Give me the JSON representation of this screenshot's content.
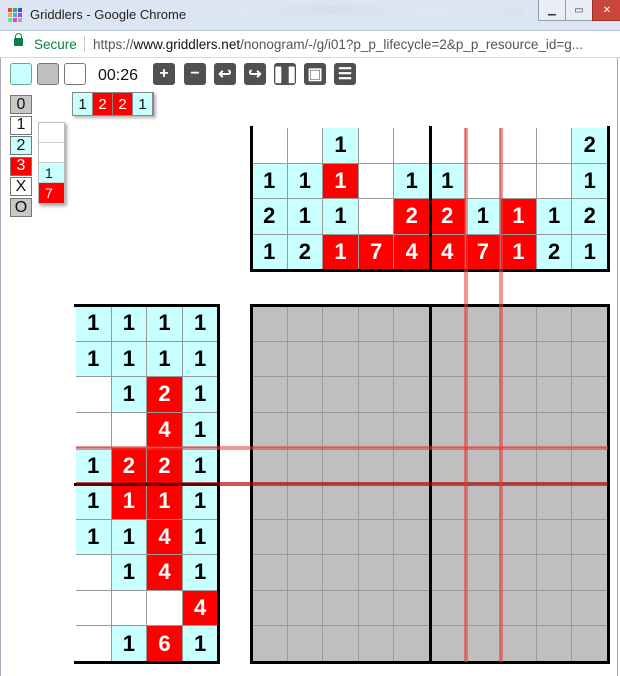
{
  "window": {
    "title": "Griddlers - Google Chrome",
    "minimize": "▁",
    "maximize": "▭",
    "close": "✕"
  },
  "address": {
    "secure_label": "Secure",
    "url_prefix": "https://",
    "url_host": "www.griddlers.net",
    "url_path": "/nonogram/-/g/i01?p_p_lifecycle=2&p_p_resource_id=g..."
  },
  "toolbar": {
    "timer": "00:26",
    "buttons": [
      "zoom-in",
      "zoom-out",
      "undo",
      "redo",
      "pause",
      "save",
      "menu"
    ],
    "icons": [
      "+",
      "−",
      "↩",
      "↪",
      "❚❚",
      "▣",
      "☰"
    ]
  },
  "palette": [
    {
      "label": "0"
    },
    {
      "label": "1"
    },
    {
      "label": "2"
    },
    {
      "label": "3"
    },
    {
      "label": "X"
    },
    {
      "label": "O"
    }
  ],
  "palette_colors": [
    "#c8c8c8",
    "#ffffff",
    "#c8ffff",
    "#ff0000",
    "#ffffff",
    "#c8c8c8"
  ],
  "column_tip": [
    " ",
    " ",
    "1",
    "7"
  ],
  "row_tip": [
    {
      "v": "1",
      "c": 1
    },
    {
      "v": "2",
      "c": 2
    },
    {
      "v": "2",
      "c": 2
    },
    {
      "v": "1",
      "c": 1
    }
  ],
  "colors": {
    "1": "#c8ffff",
    "2": "#ff0000",
    "0": "#ffffff"
  },
  "column_clues": [
    [
      {
        "v": "",
        "c": 0
      },
      {
        "v": "1",
        "c": 1
      },
      {
        "v": "2",
        "c": 1
      },
      {
        "v": "1",
        "c": 1
      }
    ],
    [
      {
        "v": "",
        "c": 0
      },
      {
        "v": "1",
        "c": 1
      },
      {
        "v": "1",
        "c": 1
      },
      {
        "v": "2",
        "c": 1
      }
    ],
    [
      {
        "v": "1",
        "c": 1
      },
      {
        "v": "1",
        "c": 2
      },
      {
        "v": "1",
        "c": 1
      },
      {
        "v": "1",
        "c": 2
      }
    ],
    [
      {
        "v": "",
        "c": 0
      },
      {
        "v": "",
        "c": 0
      },
      {
        "v": "",
        "c": 0
      },
      {
        "v": "7",
        "c": 2
      }
    ],
    [
      {
        "v": "",
        "c": 0
      },
      {
        "v": "1",
        "c": 1
      },
      {
        "v": "2",
        "c": 2
      },
      {
        "v": "4",
        "c": 2
      }
    ],
    [
      {
        "v": "",
        "c": 0
      },
      {
        "v": "1",
        "c": 1
      },
      {
        "v": "2",
        "c": 2
      },
      {
        "v": "4",
        "c": 2
      }
    ],
    [
      {
        "v": "",
        "c": 0
      },
      {
        "v": "",
        "c": 0
      },
      {
        "v": "1",
        "c": 1
      },
      {
        "v": "7",
        "c": 2
      }
    ],
    [
      {
        "v": "",
        "c": 0
      },
      {
        "v": "",
        "c": 0
      },
      {
        "v": "1",
        "c": 2
      },
      {
        "v": "1",
        "c": 2
      }
    ],
    [
      {
        "v": "",
        "c": 0
      },
      {
        "v": "",
        "c": 0
      },
      {
        "v": "1",
        "c": 1
      },
      {
        "v": "2",
        "c": 1
      }
    ],
    [
      {
        "v": "2",
        "c": 1
      },
      {
        "v": "1",
        "c": 1
      },
      {
        "v": "2",
        "c": 1
      },
      {
        "v": "1",
        "c": 1
      }
    ]
  ],
  "row_clues": [
    [
      {
        "v": "1",
        "c": 1
      },
      {
        "v": "1",
        "c": 1
      },
      {
        "v": "1",
        "c": 1
      },
      {
        "v": "1",
        "c": 1
      }
    ],
    [
      {
        "v": "1",
        "c": 1
      },
      {
        "v": "1",
        "c": 1
      },
      {
        "v": "1",
        "c": 1
      },
      {
        "v": "1",
        "c": 1
      }
    ],
    [
      {
        "v": "",
        "c": 0
      },
      {
        "v": "1",
        "c": 1
      },
      {
        "v": "2",
        "c": 2
      },
      {
        "v": "1",
        "c": 1
      }
    ],
    [
      {
        "v": "",
        "c": 0
      },
      {
        "v": "",
        "c": 0
      },
      {
        "v": "4",
        "c": 2
      },
      {
        "v": "1",
        "c": 1
      }
    ],
    [
      {
        "v": "1",
        "c": 1
      },
      {
        "v": "2",
        "c": 2
      },
      {
        "v": "2",
        "c": 2
      },
      {
        "v": "1",
        "c": 1
      }
    ],
    [
      {
        "v": "1",
        "c": 1
      },
      {
        "v": "1",
        "c": 2
      },
      {
        "v": "1",
        "c": 2
      },
      {
        "v": "1",
        "c": 1
      }
    ],
    [
      {
        "v": "1",
        "c": 1
      },
      {
        "v": "1",
        "c": 1
      },
      {
        "v": "4",
        "c": 2
      },
      {
        "v": "1",
        "c": 1
      }
    ],
    [
      {
        "v": "",
        "c": 0
      },
      {
        "v": "1",
        "c": 1
      },
      {
        "v": "4",
        "c": 2
      },
      {
        "v": "1",
        "c": 1
      }
    ],
    [
      {
        "v": "",
        "c": 0
      },
      {
        "v": "",
        "c": 0
      },
      {
        "v": "",
        "c": 0
      },
      {
        "v": "4",
        "c": 2
      }
    ],
    [
      {
        "v": "",
        "c": 0
      },
      {
        "v": "1",
        "c": 1
      },
      {
        "v": "6",
        "c": 2
      },
      {
        "v": "1",
        "c": 1
      }
    ]
  ],
  "grid": {
    "rows": 10,
    "cols": 10,
    "empty_color": "#bfbfbf"
  },
  "cursor": {
    "row": 4,
    "col": 6
  }
}
